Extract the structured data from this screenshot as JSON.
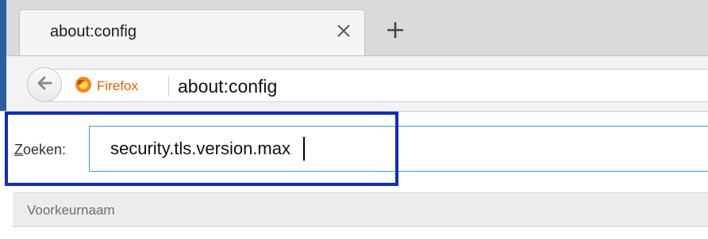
{
  "tab": {
    "title": "about:config",
    "close_icon": "close-icon",
    "new_tab_icon": "plus-icon"
  },
  "navbar": {
    "back_icon": "back-arrow-icon",
    "identity_icon": "firefox-logo-icon",
    "identity_label": "Firefox",
    "url": "about:config"
  },
  "search": {
    "label_underlined": "Z",
    "label_rest": "oeken:",
    "value": "security.tls.version.max"
  },
  "table": {
    "columns": [
      "Voorkeurnaam"
    ]
  },
  "colors": {
    "highlight": "#0d2fb5",
    "input_focus": "#3c9ad6",
    "firefox_orange": "#e66000"
  }
}
